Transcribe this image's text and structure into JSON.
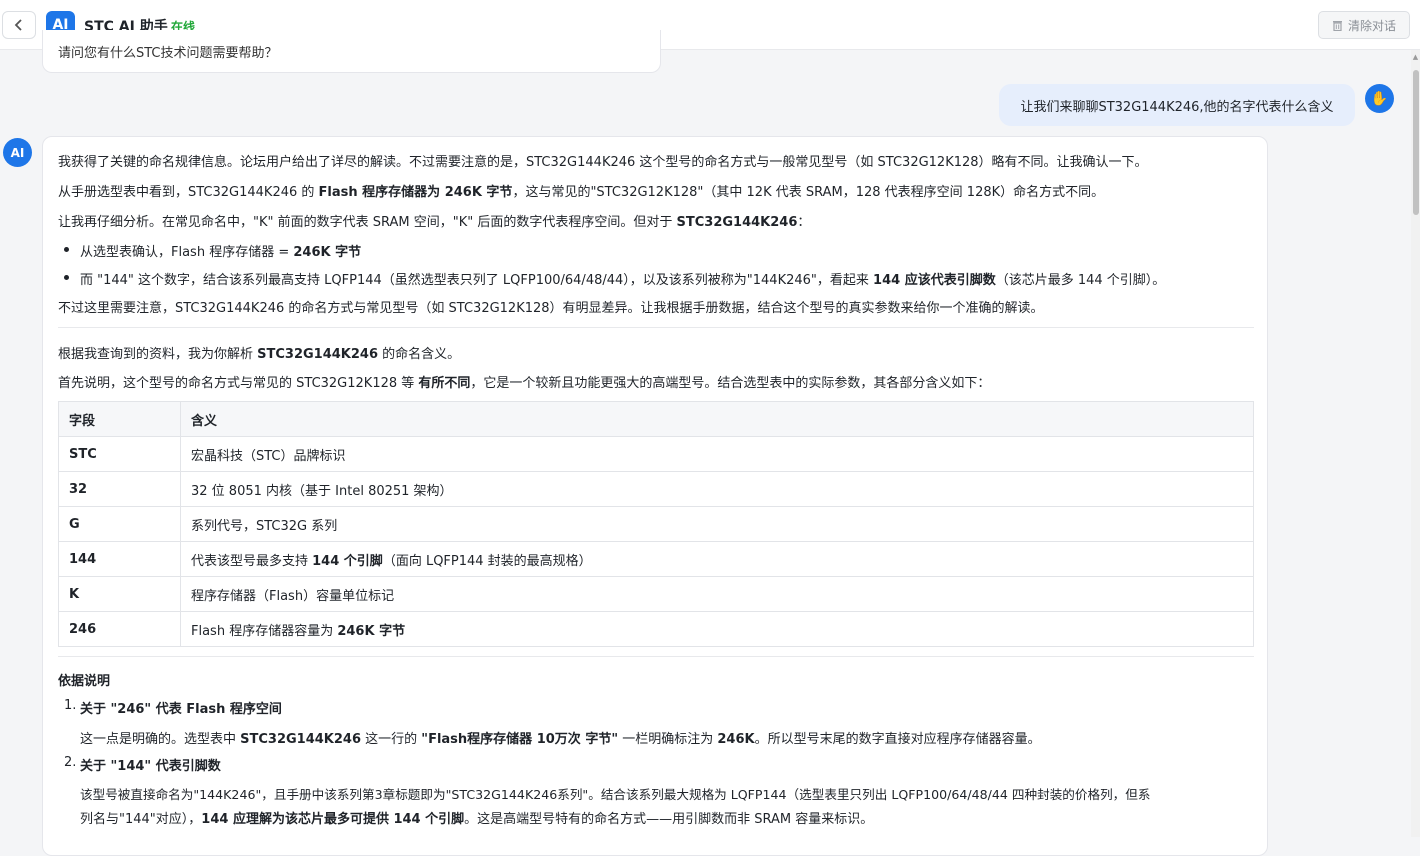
{
  "header": {
    "back_icon": "chevron-left-icon",
    "logo_text": "AI",
    "title": "STC AI 助手",
    "status": "在线",
    "clear_label": "清除对话",
    "clear_icon": "trash-icon"
  },
  "conversation": {
    "prev_ai_text": "请问您有什么STC技术问题需要帮助？",
    "user_message": "让我们来聊聊ST32G144K246,他的名字代表什么含义",
    "user_avatar_icon": "hand-icon",
    "ai_avatar_text": "AI",
    "ai": {
      "p1": "我获得了关键的命名规律信息。论坛用户给出了详尽的解读。不过需要注意的是，STC32G144K246 这个型号的命名方式与一般常见型号（如 STC32G12K128）略有不同。让我确认一下。",
      "p2_a": "从手册选型表中看到，STC32G144K246 的 ",
      "p2_b": "Flash 程序存储器为 246K 字节",
      "p2_c": "，这与常见的\"STC32G12K128\"（其中 12K 代表 SRAM，128 代表程序空间 128K）命名方式不同。",
      "p3_a": "让我再仔细分析。在常见命名中，\"K\" 前面的数字代表 SRAM 空间，\"K\" 后面的数字代表程序空间。但对于 ",
      "p3_b": "STC32G144K246",
      "p3_c": "：",
      "b1_a": "从选型表确认，Flash 程序存储器 = ",
      "b1_b": "246K 字节",
      "b2_a": "而 \"144\" 这个数字，结合该系列最高支持 LQFP144（虽然选型表只列了 LQFP100/64/48/44），以及该系列被称为\"144K246\"，看起来 ",
      "b2_b": "144 应该代表引脚数",
      "b2_c": "（该芯片最多 144 个引脚）。",
      "p4": "不过这里需要注意，STC32G144K246 的命名方式与常见型号（如 STC32G12K128）有明显差异。让我根据手册数据，结合这个型号的真实参数来给你一个准确的解读。",
      "p5_a": "根据我查询到的资料，我为你解析 ",
      "p5_b": "STC32G144K246",
      "p5_c": " 的命名含义。",
      "p6_a": "首先说明，这个型号的命名方式与常见的 STC32G12K128 等 ",
      "p6_b": "有所不同",
      "p6_c": "，它是一个较新且功能更强大的高端型号。结合选型表中的实际参数，其各部分含义如下：",
      "table": {
        "headers": [
          "字段",
          "含义"
        ],
        "rows": [
          {
            "field": "STC",
            "meaning_a": "宏晶科技（STC）品牌标识",
            "meaning_b": "",
            "meaning_c": ""
          },
          {
            "field": "32",
            "meaning_a": "32 位 8051 内核（基于 Intel 80251 架构）",
            "meaning_b": "",
            "meaning_c": ""
          },
          {
            "field": "G",
            "meaning_a": "系列代号，STC32G 系列",
            "meaning_b": "",
            "meaning_c": ""
          },
          {
            "field": "144",
            "meaning_a": "代表该型号最多支持 ",
            "meaning_b": "144 个引脚",
            "meaning_c": "（面向 LQFP144 封装的最高规格）"
          },
          {
            "field": "K",
            "meaning_a": "程序存储器（Flash）容量单位标记",
            "meaning_b": "",
            "meaning_c": ""
          },
          {
            "field": "246",
            "meaning_a": "Flash 程序存储器容量为 ",
            "meaning_b": "246K 字节",
            "meaning_c": ""
          }
        ]
      },
      "basis_title": "依据说明",
      "item1_num": "1.",
      "item1_title": "关于 \"246\" 代表 Flash 程序空间",
      "item1_a": "这一点是明确的。选型表中 ",
      "item1_b": "STC32G144K246",
      "item1_c": " 这一行的 ",
      "item1_d": "\"Flash程序存储器 10万次 字节\"",
      "item1_e": " 一栏明确标注为 ",
      "item1_f": "246K",
      "item1_g": "。所以型号末尾的数字直接对应程序存储器容量。",
      "item2_num": "2.",
      "item2_title": "关于 \"144\" 代表引脚数",
      "item2_l1": "该型号被直接命名为\"144K246\"，且手册中该系列第3章标题即为\"STC32G144K246系列\"。结合该系列最大规格为 LQFP144（选型表里只列出 LQFP100/64/48/44 四种封装的价格列，但系",
      "item2_l2_a": "列名与\"144\"对应），",
      "item2_l2_b": "144 应理解为该芯片最多可提供 144 个引脚",
      "item2_l2_c": "。这是高端型号特有的命名方式——用引脚数而非 SRAM 容量来标识。"
    }
  }
}
